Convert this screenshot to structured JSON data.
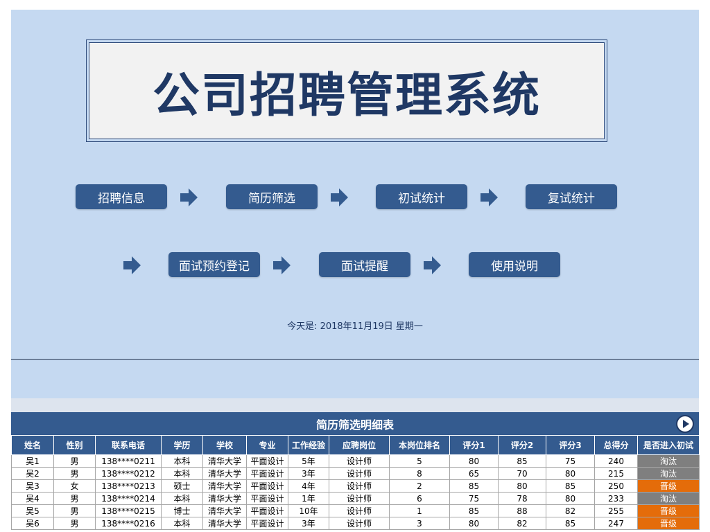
{
  "title": "公司招聘管理系统",
  "nav": [
    {
      "label": "招聘信息",
      "name": "nav-button-recruit-info"
    },
    {
      "label": "简历筛选",
      "name": "nav-button-resume-screening"
    },
    {
      "label": "初试统计",
      "name": "nav-button-first-interview-stats"
    },
    {
      "label": "复试统计",
      "name": "nav-button-second-interview-stats"
    },
    {
      "label": "面试预约登记",
      "name": "nav-button-interview-booking"
    },
    {
      "label": "面试提醒",
      "name": "nav-button-interview-reminder"
    },
    {
      "label": "使用说明",
      "name": "nav-button-instructions"
    }
  ],
  "date_text": "今天是: 2018年11月19日 星期一",
  "table": {
    "title": "简历筛选明细表",
    "columns": [
      "姓名",
      "性别",
      "联系电话",
      "学历",
      "学校",
      "专业",
      "工作经验",
      "应聘岗位",
      "本岗位排名",
      "评分1",
      "评分2",
      "评分3",
      "总得分",
      "是否进入初试"
    ],
    "rows": [
      [
        "吴1",
        "男",
        "138****0211",
        "本科",
        "清华大学",
        "平面设计",
        "5年",
        "设计师",
        "5",
        "80",
        "85",
        "75",
        "240",
        "淘汰"
      ],
      [
        "吴2",
        "男",
        "138****0212",
        "本科",
        "清华大学",
        "平面设计",
        "3年",
        "设计师",
        "8",
        "65",
        "70",
        "80",
        "215",
        "淘汰"
      ],
      [
        "吴3",
        "女",
        "138****0213",
        "硕士",
        "清华大学",
        "平面设计",
        "4年",
        "设计师",
        "2",
        "85",
        "80",
        "85",
        "250",
        "晋级"
      ],
      [
        "吴4",
        "男",
        "138****0214",
        "本科",
        "清华大学",
        "平面设计",
        "1年",
        "设计师",
        "6",
        "75",
        "78",
        "80",
        "233",
        "淘汰"
      ],
      [
        "吴5",
        "男",
        "138****0215",
        "博士",
        "清华大学",
        "平面设计",
        "10年",
        "设计师",
        "1",
        "85",
        "88",
        "82",
        "255",
        "晋级"
      ],
      [
        "吴6",
        "男",
        "138****0216",
        "本科",
        "清华大学",
        "平面设计",
        "3年",
        "设计师",
        "3",
        "80",
        "82",
        "85",
        "247",
        "晋级"
      ]
    ]
  },
  "colors": {
    "background_panel": "#c5d9f1",
    "button": "#345b8f",
    "title_text": "#1f3864",
    "status_eliminated": "#7f7f7f",
    "status_promoted": "#e46c0a"
  },
  "icons": {
    "nav_arrow": "right-arrow-icon",
    "table_play": "play-circle-icon"
  }
}
